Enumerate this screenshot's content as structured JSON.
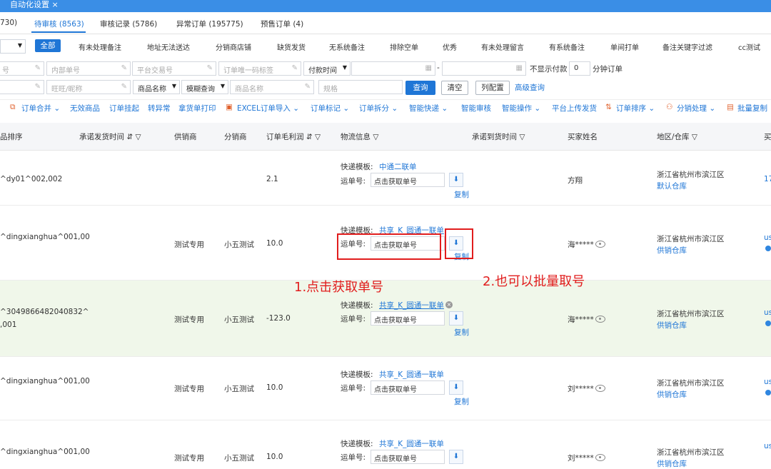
{
  "top": {
    "tab_label": "自动化设置 ×"
  },
  "status_tabs": [
    "730)",
    "待审核 (8563)",
    "审核记录 (5786)",
    "异常订单 (195775)",
    "预售订单 (4)"
  ],
  "quick_filters": {
    "all": "全部",
    "items": [
      "有未处理备注",
      "地址无法送达",
      "分销商店铺",
      "缺货发货",
      "无系统备注",
      "排除空单",
      "优秀",
      "有未处理留言",
      "有系统备注",
      "单间打单",
      "备注关键字过滤",
      "cc测试"
    ]
  },
  "search": {
    "r1_ph": [
      "号",
      "内部单号",
      "平台交易号",
      "订单唯一码标签"
    ],
    "pay_time": "付款时间",
    "date_sep": "-",
    "no_show_label": "不显示付款",
    "minutes_value": "0",
    "minutes_unit": "分钟订单",
    "r2_ph": [
      "",
      "旺旺/昵称",
      "商品名称",
      "规格"
    ],
    "product_name_sel": "商品名称",
    "fuzzy_sel": "模糊查询",
    "query_btn": "查询",
    "clear_btn": "清空",
    "config_btn": "列配置",
    "advanced_link": "高级查询"
  },
  "toolbar": {
    "items": [
      "订单合并",
      "无效商品",
      "订单挂起",
      "转异常",
      "拿货单打印",
      "EXCEL订单导入",
      "订单标记",
      "订单拆分",
      "智能快递",
      "智能审核",
      "智能操作",
      "平台上传发货",
      "订单排序",
      "分销处理",
      "批量复制"
    ]
  },
  "table": {
    "headers": [
      "品排序",
      "承诺发货时间",
      "供销商",
      "分销商",
      "订单毛利润",
      "物流信息",
      "承诺到货时间",
      "买家姓名",
      "地区/仓库",
      "买"
    ],
    "template_label": "快递模板:",
    "waybill_label": "运单号:",
    "waybill_placeholder": "点击获取单号",
    "copy_label": "复制",
    "rows": [
      {
        "sku": "^dy01^002,002",
        "sku2": "",
        "supplier": "",
        "distributor": "",
        "profit": "2.1",
        "template": "中通二联单",
        "buyer": "方翔",
        "masked": false,
        "region": "浙江省杭州市滨江区",
        "warehouse": "默认仓库",
        "right": "17"
      },
      {
        "sku": "^dingxianghua^001,00",
        "sku2": "",
        "supplier": "测试专用",
        "distributor": "小五测试",
        "profit": "10.0",
        "template": "共享_K_圆通一联单",
        "buyer": "海*****",
        "masked": true,
        "region": "浙江省杭州市滨江区",
        "warehouse": "供销仓库",
        "right": "us"
      },
      {
        "sku": "^3049866482040832^",
        "sku2": ",001",
        "supplier": "测试专用",
        "distributor": "小五测试",
        "profit": "-123.0",
        "template": "共享_K_圆通一联单",
        "buyer": "海*****",
        "masked": true,
        "region": "浙江省杭州市滨江区",
        "warehouse": "供销仓库",
        "right": "us"
      },
      {
        "sku": "^dingxianghua^001,00",
        "sku2": "",
        "supplier": "测试专用",
        "distributor": "小五测试",
        "profit": "10.0",
        "template": "共享_K_圆通一联单",
        "buyer": "刘*****",
        "masked": true,
        "region": "浙江省杭州市滨江区",
        "warehouse": "供销仓库",
        "right": "us"
      },
      {
        "sku": "^dingxianghua^001,00",
        "sku2": "",
        "supplier": "测试专用",
        "distributor": "小五测试",
        "profit": "10.0",
        "template": "共享_K_圆通一联单",
        "buyer": "刘*****",
        "masked": true,
        "region": "浙江省杭州市滨江区",
        "warehouse": "供销仓库",
        "right": "us"
      }
    ]
  },
  "annotations": {
    "step1": "1.点击获取单号",
    "step2": "2.也可以批量取号"
  },
  "colors": {
    "primary": "#1f76d6",
    "annotation": "#e11d1d",
    "highlight_row": "#f0f7ea"
  }
}
